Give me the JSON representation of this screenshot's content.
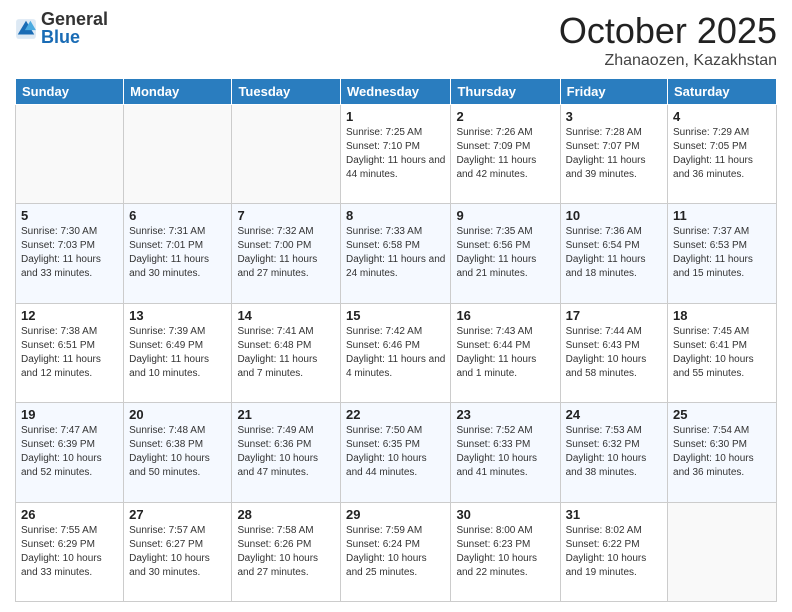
{
  "logo": {
    "general": "General",
    "blue": "Blue"
  },
  "header": {
    "month": "October 2025",
    "location": "Zhanaozen, Kazakhstan"
  },
  "weekdays": [
    "Sunday",
    "Monday",
    "Tuesday",
    "Wednesday",
    "Thursday",
    "Friday",
    "Saturday"
  ],
  "weeks": [
    [
      {
        "day": "",
        "sunrise": "",
        "sunset": "",
        "daylight": ""
      },
      {
        "day": "",
        "sunrise": "",
        "sunset": "",
        "daylight": ""
      },
      {
        "day": "",
        "sunrise": "",
        "sunset": "",
        "daylight": ""
      },
      {
        "day": "1",
        "sunrise": "Sunrise: 7:25 AM",
        "sunset": "Sunset: 7:10 PM",
        "daylight": "Daylight: 11 hours and 44 minutes."
      },
      {
        "day": "2",
        "sunrise": "Sunrise: 7:26 AM",
        "sunset": "Sunset: 7:09 PM",
        "daylight": "Daylight: 11 hours and 42 minutes."
      },
      {
        "day": "3",
        "sunrise": "Sunrise: 7:28 AM",
        "sunset": "Sunset: 7:07 PM",
        "daylight": "Daylight: 11 hours and 39 minutes."
      },
      {
        "day": "4",
        "sunrise": "Sunrise: 7:29 AM",
        "sunset": "Sunset: 7:05 PM",
        "daylight": "Daylight: 11 hours and 36 minutes."
      }
    ],
    [
      {
        "day": "5",
        "sunrise": "Sunrise: 7:30 AM",
        "sunset": "Sunset: 7:03 PM",
        "daylight": "Daylight: 11 hours and 33 minutes."
      },
      {
        "day": "6",
        "sunrise": "Sunrise: 7:31 AM",
        "sunset": "Sunset: 7:01 PM",
        "daylight": "Daylight: 11 hours and 30 minutes."
      },
      {
        "day": "7",
        "sunrise": "Sunrise: 7:32 AM",
        "sunset": "Sunset: 7:00 PM",
        "daylight": "Daylight: 11 hours and 27 minutes."
      },
      {
        "day": "8",
        "sunrise": "Sunrise: 7:33 AM",
        "sunset": "Sunset: 6:58 PM",
        "daylight": "Daylight: 11 hours and 24 minutes."
      },
      {
        "day": "9",
        "sunrise": "Sunrise: 7:35 AM",
        "sunset": "Sunset: 6:56 PM",
        "daylight": "Daylight: 11 hours and 21 minutes."
      },
      {
        "day": "10",
        "sunrise": "Sunrise: 7:36 AM",
        "sunset": "Sunset: 6:54 PM",
        "daylight": "Daylight: 11 hours and 18 minutes."
      },
      {
        "day": "11",
        "sunrise": "Sunrise: 7:37 AM",
        "sunset": "Sunset: 6:53 PM",
        "daylight": "Daylight: 11 hours and 15 minutes."
      }
    ],
    [
      {
        "day": "12",
        "sunrise": "Sunrise: 7:38 AM",
        "sunset": "Sunset: 6:51 PM",
        "daylight": "Daylight: 11 hours and 12 minutes."
      },
      {
        "day": "13",
        "sunrise": "Sunrise: 7:39 AM",
        "sunset": "Sunset: 6:49 PM",
        "daylight": "Daylight: 11 hours and 10 minutes."
      },
      {
        "day": "14",
        "sunrise": "Sunrise: 7:41 AM",
        "sunset": "Sunset: 6:48 PM",
        "daylight": "Daylight: 11 hours and 7 minutes."
      },
      {
        "day": "15",
        "sunrise": "Sunrise: 7:42 AM",
        "sunset": "Sunset: 6:46 PM",
        "daylight": "Daylight: 11 hours and 4 minutes."
      },
      {
        "day": "16",
        "sunrise": "Sunrise: 7:43 AM",
        "sunset": "Sunset: 6:44 PM",
        "daylight": "Daylight: 11 hours and 1 minute."
      },
      {
        "day": "17",
        "sunrise": "Sunrise: 7:44 AM",
        "sunset": "Sunset: 6:43 PM",
        "daylight": "Daylight: 10 hours and 58 minutes."
      },
      {
        "day": "18",
        "sunrise": "Sunrise: 7:45 AM",
        "sunset": "Sunset: 6:41 PM",
        "daylight": "Daylight: 10 hours and 55 minutes."
      }
    ],
    [
      {
        "day": "19",
        "sunrise": "Sunrise: 7:47 AM",
        "sunset": "Sunset: 6:39 PM",
        "daylight": "Daylight: 10 hours and 52 minutes."
      },
      {
        "day": "20",
        "sunrise": "Sunrise: 7:48 AM",
        "sunset": "Sunset: 6:38 PM",
        "daylight": "Daylight: 10 hours and 50 minutes."
      },
      {
        "day": "21",
        "sunrise": "Sunrise: 7:49 AM",
        "sunset": "Sunset: 6:36 PM",
        "daylight": "Daylight: 10 hours and 47 minutes."
      },
      {
        "day": "22",
        "sunrise": "Sunrise: 7:50 AM",
        "sunset": "Sunset: 6:35 PM",
        "daylight": "Daylight: 10 hours and 44 minutes."
      },
      {
        "day": "23",
        "sunrise": "Sunrise: 7:52 AM",
        "sunset": "Sunset: 6:33 PM",
        "daylight": "Daylight: 10 hours and 41 minutes."
      },
      {
        "day": "24",
        "sunrise": "Sunrise: 7:53 AM",
        "sunset": "Sunset: 6:32 PM",
        "daylight": "Daylight: 10 hours and 38 minutes."
      },
      {
        "day": "25",
        "sunrise": "Sunrise: 7:54 AM",
        "sunset": "Sunset: 6:30 PM",
        "daylight": "Daylight: 10 hours and 36 minutes."
      }
    ],
    [
      {
        "day": "26",
        "sunrise": "Sunrise: 7:55 AM",
        "sunset": "Sunset: 6:29 PM",
        "daylight": "Daylight: 10 hours and 33 minutes."
      },
      {
        "day": "27",
        "sunrise": "Sunrise: 7:57 AM",
        "sunset": "Sunset: 6:27 PM",
        "daylight": "Daylight: 10 hours and 30 minutes."
      },
      {
        "day": "28",
        "sunrise": "Sunrise: 7:58 AM",
        "sunset": "Sunset: 6:26 PM",
        "daylight": "Daylight: 10 hours and 27 minutes."
      },
      {
        "day": "29",
        "sunrise": "Sunrise: 7:59 AM",
        "sunset": "Sunset: 6:24 PM",
        "daylight": "Daylight: 10 hours and 25 minutes."
      },
      {
        "day": "30",
        "sunrise": "Sunrise: 8:00 AM",
        "sunset": "Sunset: 6:23 PM",
        "daylight": "Daylight: 10 hours and 22 minutes."
      },
      {
        "day": "31",
        "sunrise": "Sunrise: 8:02 AM",
        "sunset": "Sunset: 6:22 PM",
        "daylight": "Daylight: 10 hours and 19 minutes."
      },
      {
        "day": "",
        "sunrise": "",
        "sunset": "",
        "daylight": ""
      }
    ]
  ]
}
